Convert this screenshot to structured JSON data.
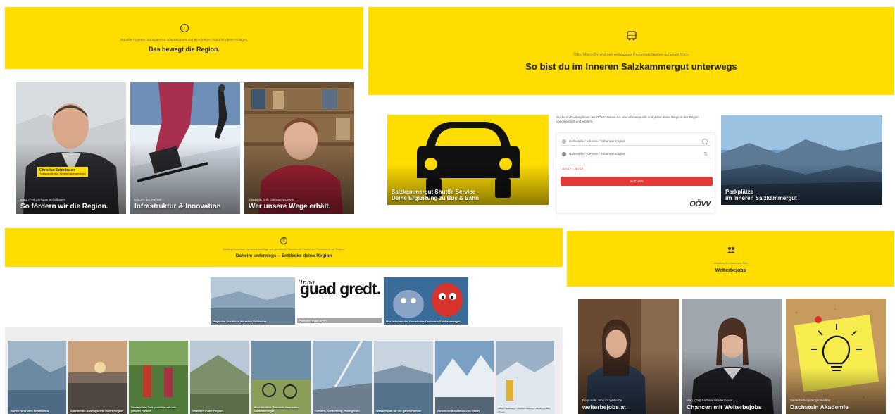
{
  "panel_region": {
    "subtitle": "Aktuelle Projekte, transparente Informationen und ein direkter Draht für deine Anliegen.",
    "title": "Das bewegt die Region.",
    "cards": [
      {
        "person_name": "Christian Schirlbauer",
        "person_role": "Tourismusdirektor Inneres Salzkammergut",
        "subtitle": "Mag. (FH) Christian Schirlbauer",
        "title": "So fördern wir die Region."
      },
      {
        "subtitle": "Mit uns der Freizeit…",
        "title": "Infrastruktur & Innovation"
      },
      {
        "subtitle": "Elisabeth Grill, Obfrau GEOMAN",
        "title": "Wer unsere Wege erhält."
      }
    ]
  },
  "panel_travel": {
    "subtitle": "Öffis, Mikro-ÖV und den wichtigsten Parkmöglichkeiten auf einen Blick.",
    "title": "So bist du im Inneren Salzkammergut unterwegs",
    "shuttle_title": "Salzkammergut Shuttle Service",
    "shuttle_subtitle": "Deine Ergänzung zu Bus & Bahn",
    "planner": {
      "intro": "Suche im Routenplaner des OÖVV deinen An- und Abreisepunkt und plane deine Wege in der Region unkompliziert und einfach.",
      "from_placeholder": "Haltestelle / Adresse / Sehenswürdigkeit",
      "to_placeholder": "Haltestelle / Adresse / Sehenswürdigkeit",
      "time_link": "JETZT · JETZT",
      "search_label": "SUCHEN",
      "logo": "OÖVV"
    },
    "parking_title": "Parkplätze",
    "parking_subtitle": "im Inneren Salzkammergut"
  },
  "panel_home": {
    "subtitle": "Insidergeheimnisse, spontane Ausflüge und gemütliche Stunden mit Familie und Freunden in der Region.",
    "title": "Daheim unterwegs – Entdecke deine Region",
    "features": [
      {
        "caption": "Magische Ausblicke für echte Entdecker"
      },
      {
        "logo_top": "'Inha",
        "logo": "guad gredt.",
        "caption": "Podcast: guad gredt"
      },
      {
        "caption": "Maskottchen der Gemeinden Dachstein Salzkammergut"
      }
    ],
    "tiles": [
      "Touren rund ums Feierabend",
      "Spannende Ausflugsziele in der Region",
      "Gemeinsam Zeit genießen mit der ganzen Familie",
      "Wandern in der Region",
      "Mountainbike Paradies Dachstein Salzkammergut",
      "Klettern, Klettersteig, Hochgefühl",
      "Wasserspaß für die ganze Familie",
      "Ausblicke auf Almen und Gipfel",
      "Wild. Wander. Wölfe. Winter abseits der Piste"
    ]
  },
  "panel_jobs": {
    "subtitle": "Arbeiten & Leben am See",
    "title": "Welterbejobs",
    "cards": [
      {
        "subtitle": "Regionale Jobs im Welterbe",
        "title": "welterbejobs.at"
      },
      {
        "subtitle": "Mag. (FH) Barbara Waldenbauer",
        "title": "Chancen mit Welterbejobs"
      },
      {
        "subtitle": "Weiterbildungsmöglichkeiten",
        "title": "Dachstein Akademie"
      }
    ]
  },
  "colors": {
    "brand_yellow": "#ffdd00",
    "search_red": "#e53935"
  }
}
